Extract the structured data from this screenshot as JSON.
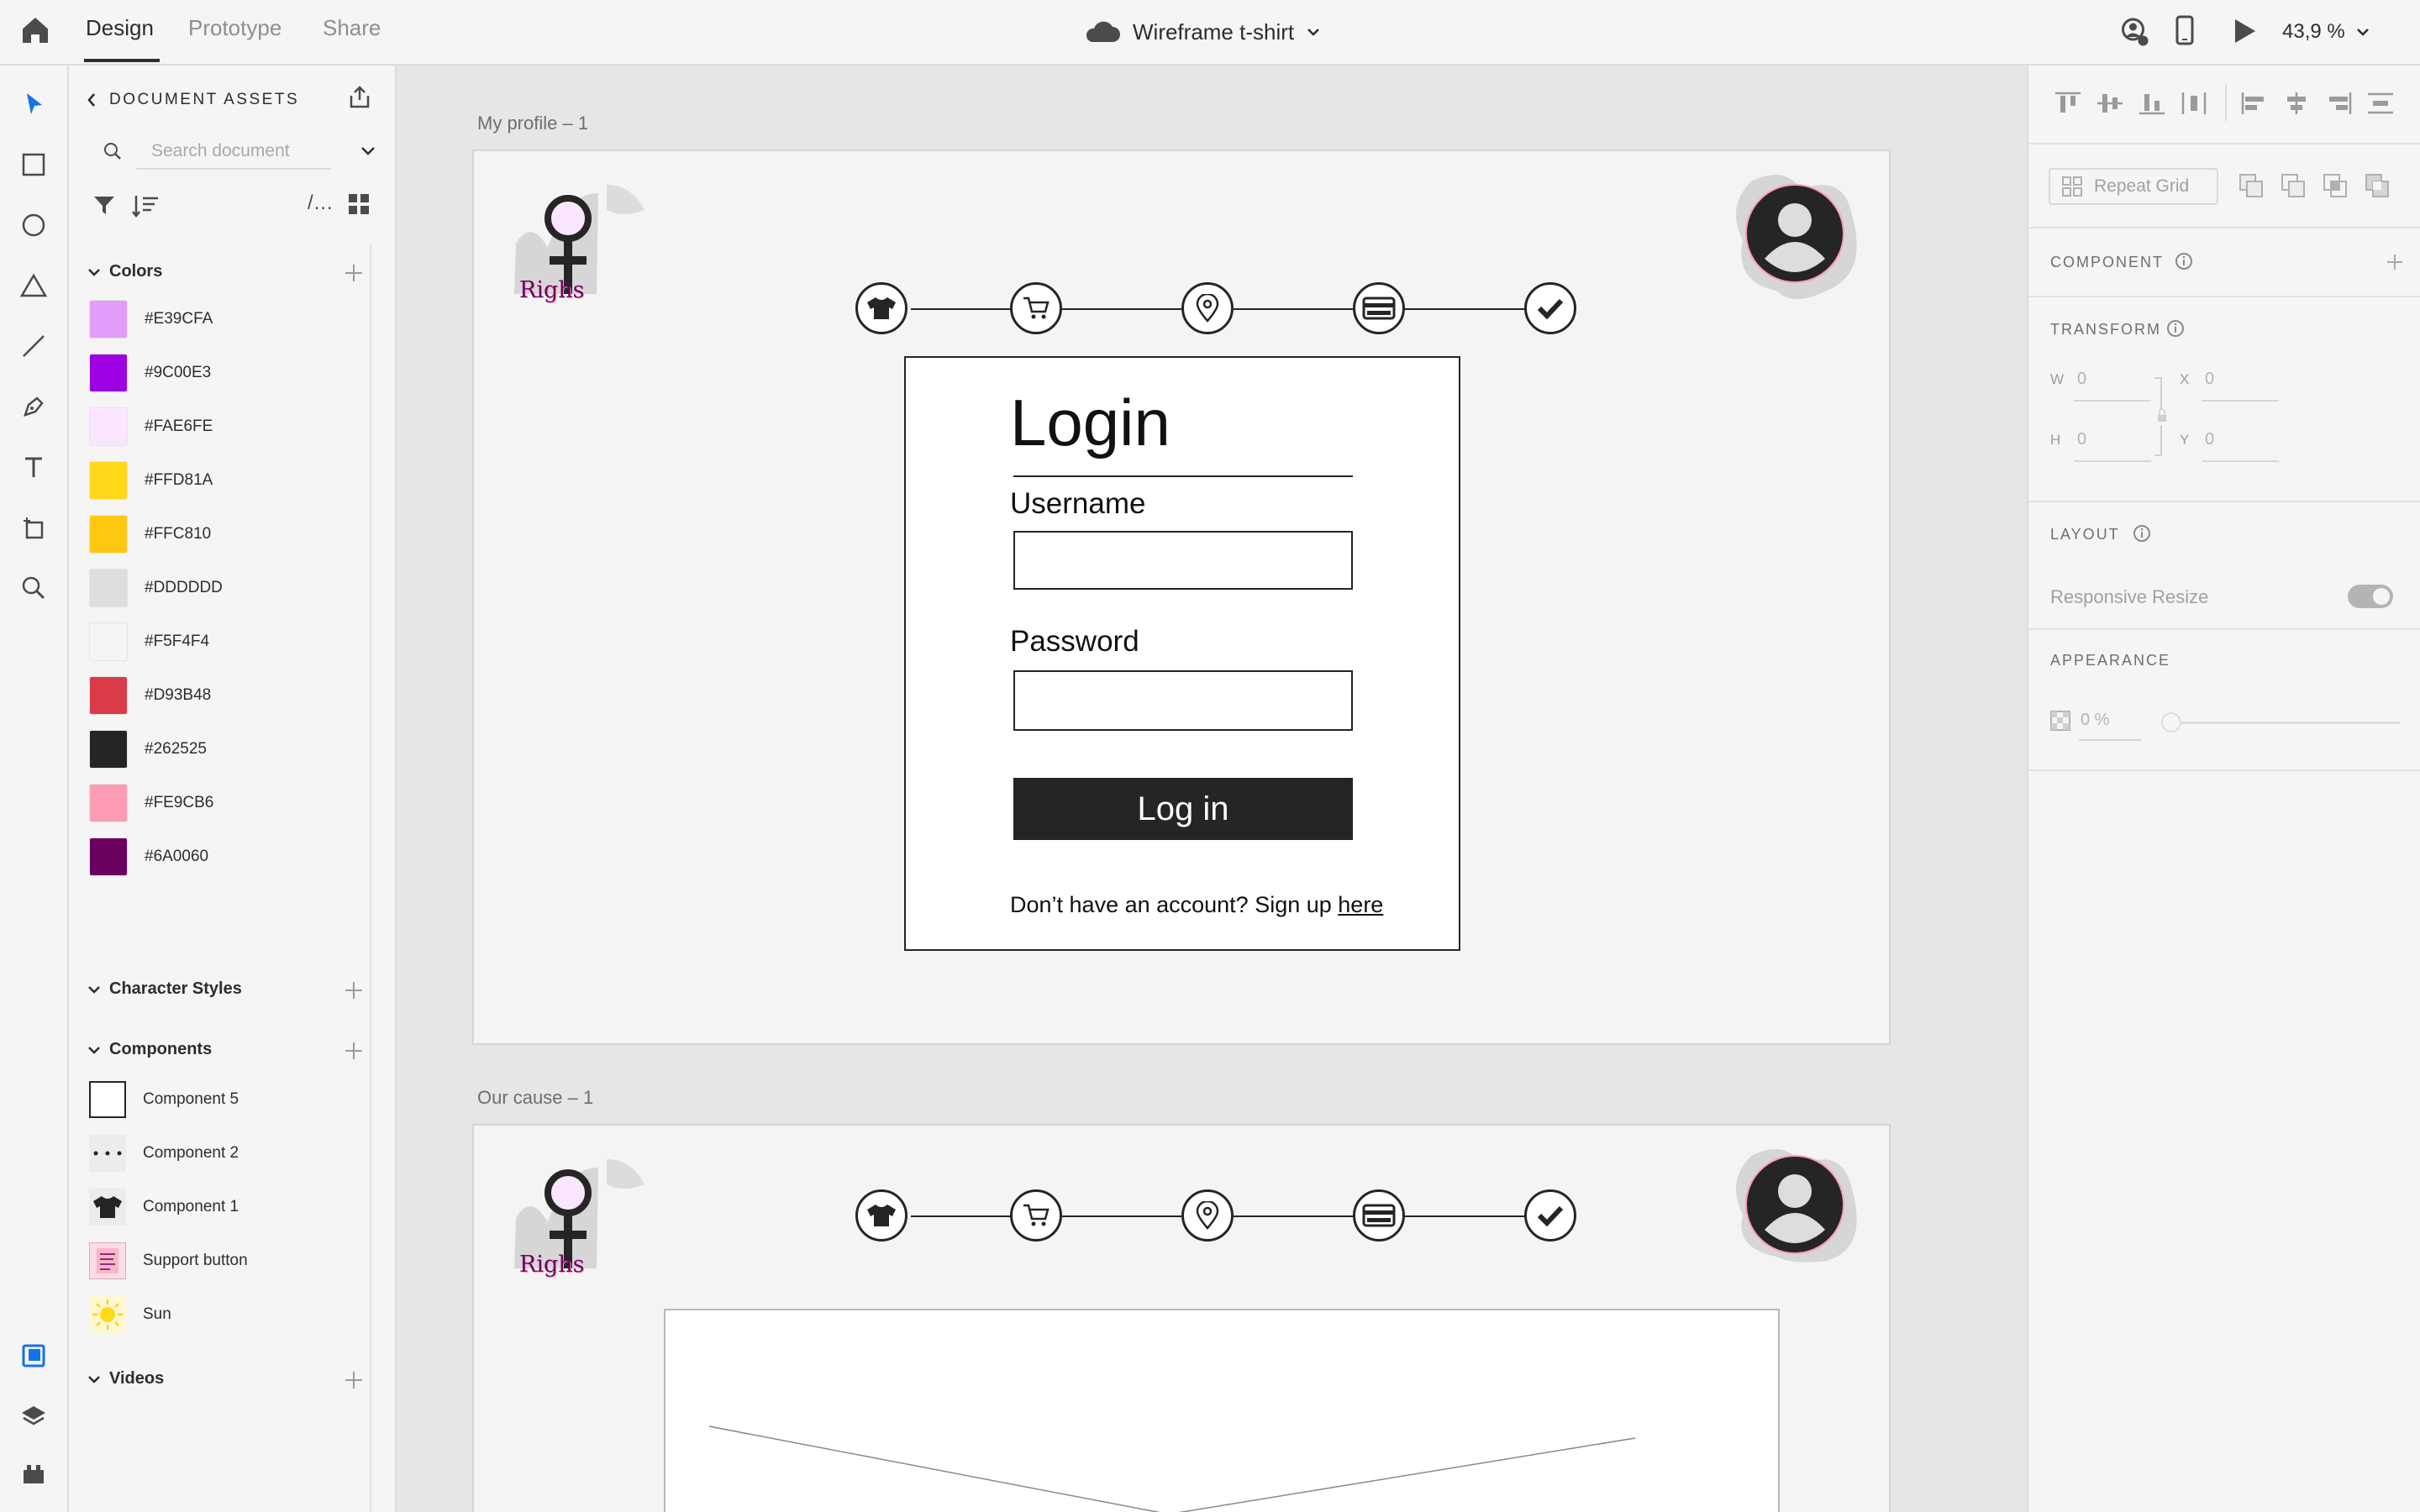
{
  "topbar": {
    "tabs": [
      "Design",
      "Prototype",
      "Share"
    ],
    "doc_title": "Wireframe t-shirt",
    "zoom": "43,9 %"
  },
  "assets": {
    "title": "DOCUMENT ASSETS",
    "search_placeholder": "Search document",
    "sections": {
      "colors": "Colors",
      "character_styles": "Character Styles",
      "components": "Components",
      "videos": "Videos"
    },
    "colors": [
      "#E39CFA",
      "#9C00E3",
      "#FAE6FE",
      "#FFD81A",
      "#FFC810",
      "#DDDDDD",
      "#F5F4F4",
      "#D93B48",
      "#262525",
      "#FE9CB6",
      "#6A0060"
    ],
    "components": [
      "Component 5",
      "Component 2",
      "Component 1",
      "Support button",
      "Sun"
    ]
  },
  "right_panel": {
    "repeat_grid": "Repeat Grid",
    "component": "COMPONENT",
    "transform": "TRANSFORM",
    "w_label": "W",
    "w_value": "0",
    "x_label": "X",
    "x_value": "0",
    "h_label": "H",
    "h_value": "0",
    "y_label": "Y",
    "y_value": "0",
    "layout": "LAYOUT",
    "responsive_resize": "Responsive Resize",
    "appearance": "APPEARANCE",
    "opacity": "0 %"
  },
  "canvas": {
    "artboard1_label": "My profile – 1",
    "artboard2_label": "Our cause – 1",
    "logo_text": "Righs",
    "login": {
      "title": "Login",
      "username_label": "Username",
      "password_label": "Password",
      "button_label": "Log in",
      "signup_text": "Don’t have an account? Sign up ",
      "signup_link": "here"
    }
  },
  "colors": {
    "accent_blue": "#1473e6",
    "dark": "#262525",
    "logo_pink": "#FE9CB6"
  }
}
